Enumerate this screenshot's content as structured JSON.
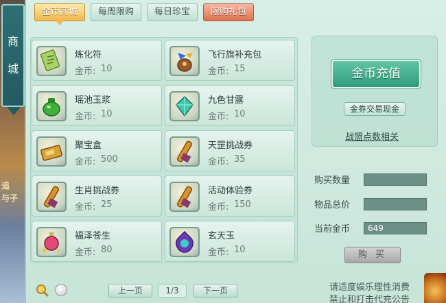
{
  "title": "商城",
  "title_chars": [
    "商",
    "城"
  ],
  "tabs": [
    {
      "label": "金币商城",
      "state": "active"
    },
    {
      "label": "每周限购",
      "state": "normal"
    },
    {
      "label": "每日珍宝",
      "state": "normal"
    },
    {
      "label": "限购礼包",
      "state": "special"
    }
  ],
  "price_label": "金币:",
  "items": [
    {
      "name": "炼化符",
      "price": "10",
      "icon": "talisman-icon"
    },
    {
      "name": "飞行旗补充包",
      "price": "15",
      "icon": "flag-bag-icon"
    },
    {
      "name": "瑶池玉浆",
      "price": "10",
      "icon": "jade-jar-icon"
    },
    {
      "name": "九色甘露",
      "price": "10",
      "icon": "nectar-gem-icon"
    },
    {
      "name": "聚宝盒",
      "price": "500",
      "icon": "treasure-box-icon"
    },
    {
      "name": "天罡挑战券",
      "price": "35",
      "icon": "scroll-icon"
    },
    {
      "name": "生肖挑战券",
      "price": "25",
      "icon": "scroll-icon"
    },
    {
      "name": "活动体验券",
      "price": "150",
      "icon": "scroll-icon"
    },
    {
      "name": "福泽苍生",
      "price": "80",
      "icon": "potion-bottle-icon"
    },
    {
      "name": "玄天玉",
      "price": "10",
      "icon": "jade-pendant-icon"
    }
  ],
  "right": {
    "recharge": "金币充值",
    "exchange": "金券交易现金",
    "points": "战盟点数相关",
    "qty_label": "购买数量",
    "qty_value": "",
    "total_label": "物品总价",
    "total_value": "",
    "gold_label": "当前金币",
    "gold_value": "649",
    "buy": "购 买"
  },
  "pagination": {
    "prev": "上一页",
    "page": "1/3",
    "next": "下一页"
  },
  "notice": [
    "请适度娱乐理性消费",
    "禁止和打击代充公告"
  ],
  "scenery_text": [
    "追",
    "与子"
  ],
  "colors": {
    "accent": "#2f9b7a",
    "active_tab": "#f2b74e",
    "special_tab": "#d97250"
  }
}
